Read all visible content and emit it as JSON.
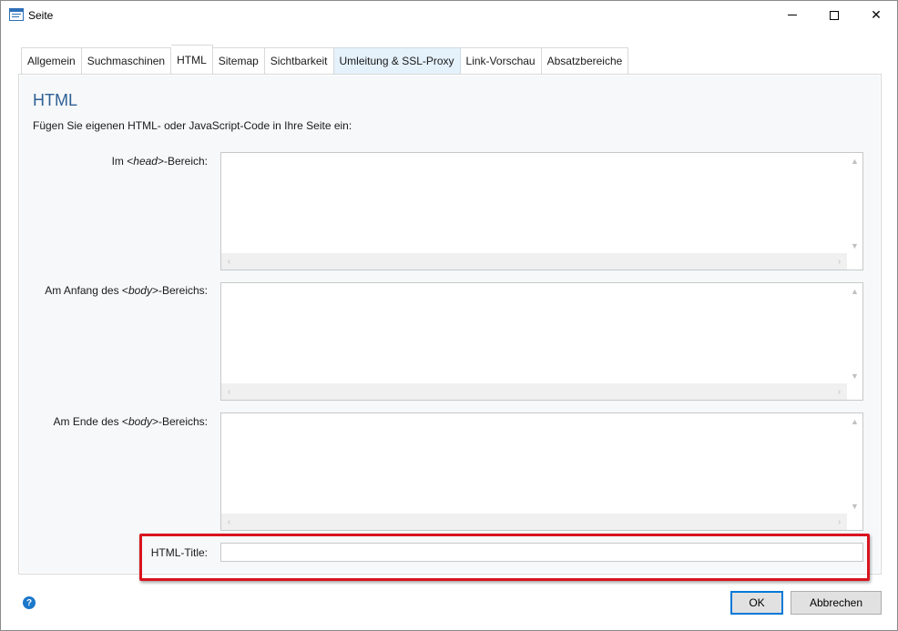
{
  "window": {
    "title": "Seite"
  },
  "tabs": [
    {
      "label": "Allgemein"
    },
    {
      "label": "Suchmaschinen"
    },
    {
      "label": "HTML"
    },
    {
      "label": "Sitemap"
    },
    {
      "label": "Sichtbarkeit"
    },
    {
      "label": "Umleitung & SSL-Proxy"
    },
    {
      "label": "Link-Vorschau"
    },
    {
      "label": "Absatzbereiche"
    }
  ],
  "active_tab": "HTML",
  "section": {
    "heading": "HTML",
    "intro": "Fügen Sie eigenen HTML- oder JavaScript-Code in Ihre Seite ein:"
  },
  "fields": {
    "head": {
      "prefix": "Im <",
      "tag": "head",
      "suffix": ">-Bereich:",
      "value": ""
    },
    "body_start": {
      "prefix": "Am Anfang des <",
      "tag": "body",
      "suffix": ">-Bereichs:",
      "value": ""
    },
    "body_end": {
      "prefix": "Am Ende des <",
      "tag": "body",
      "suffix": ">-Bereichs:",
      "value": ""
    },
    "html_title": {
      "label": "HTML-Title:",
      "value": ""
    }
  },
  "footer": {
    "help_icon": "?",
    "ok_label": "OK",
    "cancel_label": "Abbrechen"
  },
  "colors": {
    "accent": "#0078d7",
    "heading": "#2f5f93",
    "highlight": "#d9141e",
    "help": "#1c78c9"
  }
}
